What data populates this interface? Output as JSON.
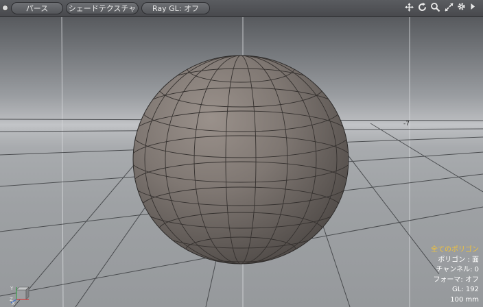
{
  "toolbar": {
    "view_mode": "パース",
    "shading_mode": "シェードテクスチャ",
    "ray_gl": "Ray GL: オフ"
  },
  "nav_icons": [
    "move-icon",
    "rotate-icon",
    "zoom-icon",
    "fit-icon",
    "gear-icon",
    "expand-arrow-icon"
  ],
  "info": {
    "selection": "全てのポリゴン",
    "polygons": "ポリゴン : 面",
    "channels": "チャンネル: 0",
    "forma": "フォーマ: オフ",
    "gl": "GL: 192",
    "scale": "100 mm"
  },
  "grid_tick": "-7",
  "axis": {
    "y": "Y",
    "z": "Z",
    "x": "X"
  },
  "colors": {
    "selection_text": "#f0c23a",
    "sphere": "#7d7570",
    "grid_line": "#2e3033"
  }
}
